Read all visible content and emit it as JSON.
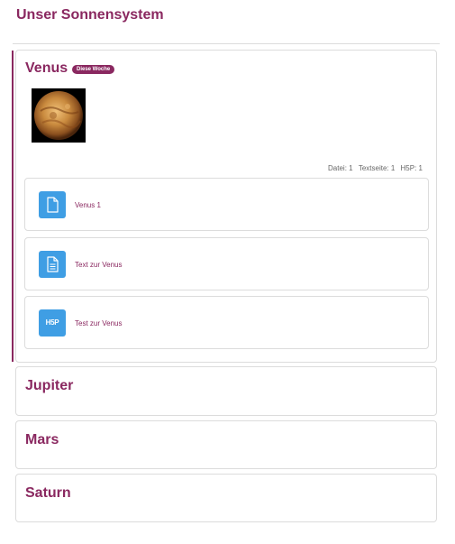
{
  "course": {
    "title": "Unser Sonnensystem"
  },
  "sections": {
    "venus": {
      "title": "Venus",
      "badge": "Diese Woche",
      "image": "venus-planet-photo",
      "completion": {
        "file": "Datei: 1",
        "textpage": "Textseite: 1",
        "h5p": "H5P: 1"
      },
      "activities": [
        {
          "label": "Venus 1",
          "icon": "file-icon"
        },
        {
          "label": "Text zur Venus",
          "icon": "document-icon"
        },
        {
          "label": "Test zur Venus",
          "icon": "h5p-icon",
          "icon_text": "H5P"
        }
      ]
    },
    "jupiter": {
      "title": "Jupiter"
    },
    "mars": {
      "title": "Mars"
    },
    "saturn": {
      "title": "Saturn"
    }
  },
  "colors": {
    "accent": "#8a2860",
    "icon_bg": "#3f9ee4",
    "border": "#dcdcdc"
  }
}
